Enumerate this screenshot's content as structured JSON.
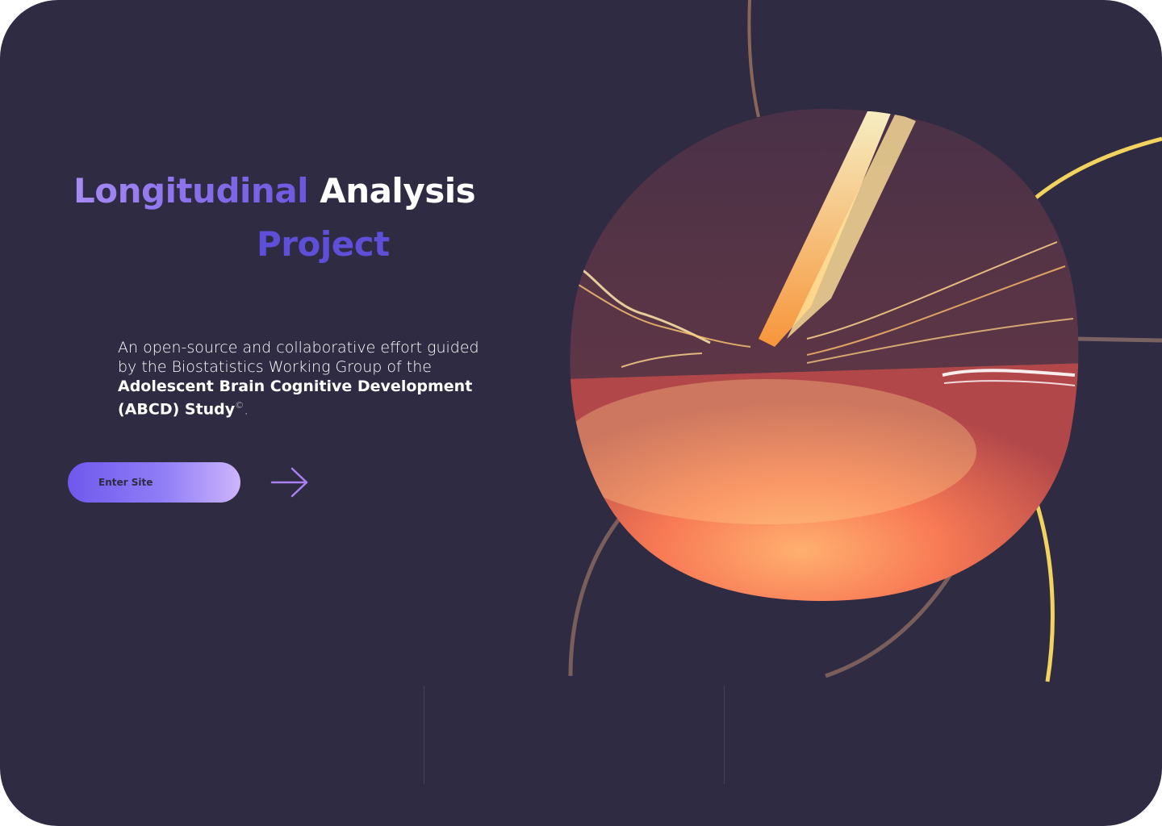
{
  "hero": {
    "title_word1": "Longitudinal",
    "title_word2": "Analysis",
    "title_word3": "Project",
    "desc_plain1": "An open-source and collaborative effort guided by the Biostatistics Working Group of the ",
    "desc_bold": "Adolescent Brain Cognitive Development (ABCD) Study",
    "desc_sup": "©",
    "desc_end": "."
  },
  "cta": {
    "button_label": "Enter Site",
    "arrow_icon": "arrow-right-icon"
  },
  "image": {
    "subject": "light-trails-tunnel"
  },
  "colors": {
    "background": "#2f2b42",
    "accent_purple": "#6d56e0",
    "accent_yellow": "#f2d35f",
    "arc_brown": "#7a5e5c"
  }
}
